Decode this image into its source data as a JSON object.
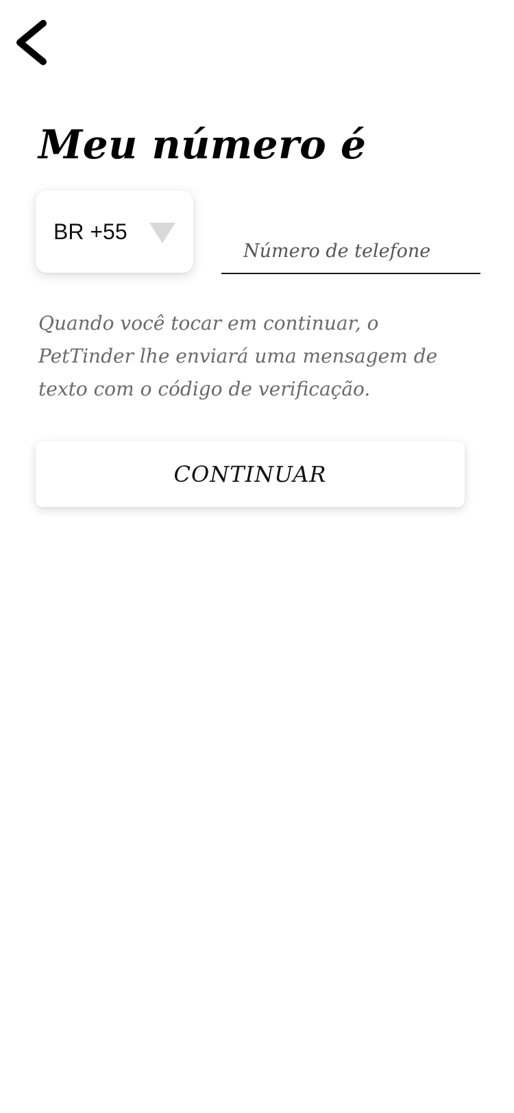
{
  "header": {
    "back_icon": "chevron-left-icon"
  },
  "title": "Meu número é",
  "country_select": {
    "value": "BR +55",
    "arrow_icon": "triangle-down-icon",
    "arrow_color": "#d9d9d9"
  },
  "phone_input": {
    "placeholder": "Número de telefone",
    "value": ""
  },
  "info_text": "Quando você tocar em continuar, o PetTinder lhe enviará uma mensagem de texto com o código de verificação.",
  "continue_button": {
    "label": "CONTINUAR"
  },
  "colors": {
    "background": "#ffffff",
    "text_primary": "#000000",
    "text_secondary": "#6a6a6a"
  }
}
